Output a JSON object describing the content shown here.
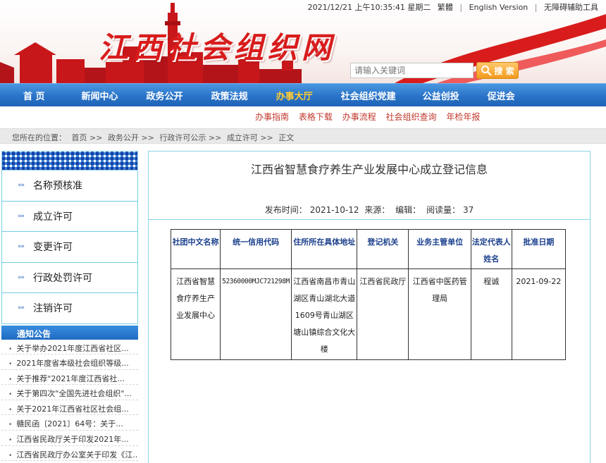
{
  "topbar": {
    "datetime": "2021/12/21 上午10:35:41 星期二",
    "traditional": "繁體",
    "english": "English Version",
    "accessibility": "无障碍辅助工具"
  },
  "site": {
    "title": "江西社会组织网"
  },
  "search": {
    "placeholder": "请输入关键词",
    "button_label": "搜 索"
  },
  "nav": {
    "items": [
      "首 页",
      "新闻中心",
      "政务公开",
      "政策法规",
      "办事大厅",
      "社会组织党建",
      "公益创投",
      "促进会"
    ],
    "active_index": 4
  },
  "subnav": {
    "items": [
      "办事指南",
      "表格下载",
      "办事流程",
      "社会组织查询",
      "年检年报"
    ]
  },
  "breadcrumb": {
    "prefix": "您所在的位置：",
    "items": [
      "首页",
      "政务公开",
      "行政许可公示",
      "成立许可",
      "正文"
    ],
    "separator": ">>"
  },
  "sidebar": {
    "items": [
      "名称预核准",
      "成立许可",
      "变更许可",
      "行政处罚许可",
      "注销许可"
    ],
    "notice_title": "通知公告",
    "notices": [
      "关于举办2021年度江西省社区...",
      "2021年度省本级社会组织等级...",
      "关于推荐\"2021年度江西省社...",
      "关于第四次\"全国先进社会组织\"...",
      "关于2021年江西省社区社会组...",
      "赣民函〔2021〕64号：关于...",
      "江西省民政厅关于印发2021年...",
      "江西省民政厅办公室关于印发《江..."
    ]
  },
  "article": {
    "title": "江西省智慧食疗养生产业发展中心成立登记信息",
    "publish_label": "发布时间：",
    "publish_date": "2021-10-12",
    "source_label": "来源：",
    "editor_label": "编辑：",
    "views_label": "阅读量：",
    "views": "37"
  },
  "table": {
    "headers": [
      "社团中文名称",
      "统一信用代码",
      "住所所在具体地址",
      "登记机关",
      "业务主管单位",
      "法定代表人姓名",
      "批准日期"
    ],
    "row": [
      "江西省智慧食疗养生产业发展中心",
      "52360000MJC721298M",
      "江西省南昌市青山湖区青山湖北大道1609号青山湖区塘山镇综合文化大楼",
      "江西省民政厅",
      "江西省中医药管理局",
      "程诚",
      "2021-09-22"
    ]
  },
  "colors": {
    "brand_red": "#d81c1c",
    "nav_blue": "#2a73c8",
    "nav_active": "#ffcc33",
    "border_cyan": "#8ad4e8"
  }
}
